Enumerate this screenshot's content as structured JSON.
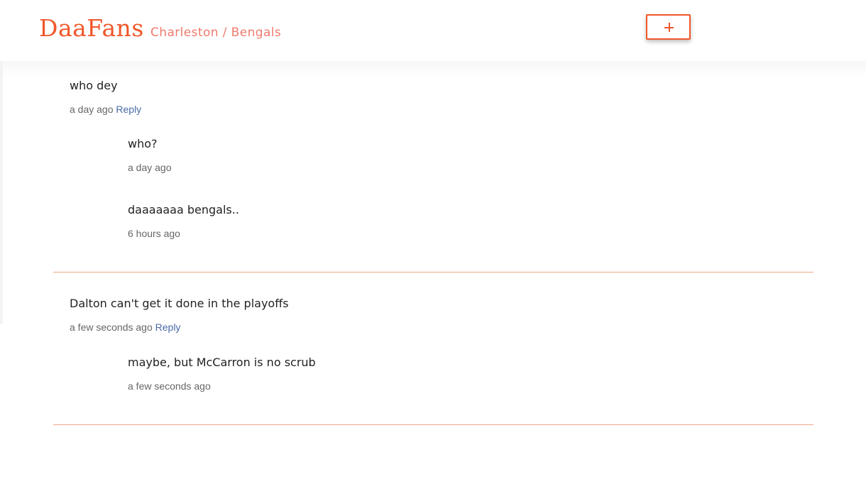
{
  "header": {
    "brand": "DaaFans",
    "location": "Charleston / Bengals",
    "add_button_icon": "plus-icon"
  },
  "threads": [
    {
      "text": "who dey",
      "time": "a day ago",
      "reply_label": "Reply",
      "replies": [
        {
          "text": "who?",
          "time": "a day ago"
        },
        {
          "text": "daaaaaaa bengals..",
          "time": "6 hours ago"
        }
      ]
    },
    {
      "text": "Dalton can't get it done in the playoffs",
      "time": "a few seconds ago",
      "reply_label": "Reply",
      "replies": [
        {
          "text": "maybe, but McCarron is no scrub",
          "time": "a few seconds ago"
        }
      ]
    }
  ],
  "colors": {
    "brand": "#f0572a",
    "location": "#f07a6e",
    "reply_link": "#4a6aa8",
    "divider": "#f2a58a"
  }
}
